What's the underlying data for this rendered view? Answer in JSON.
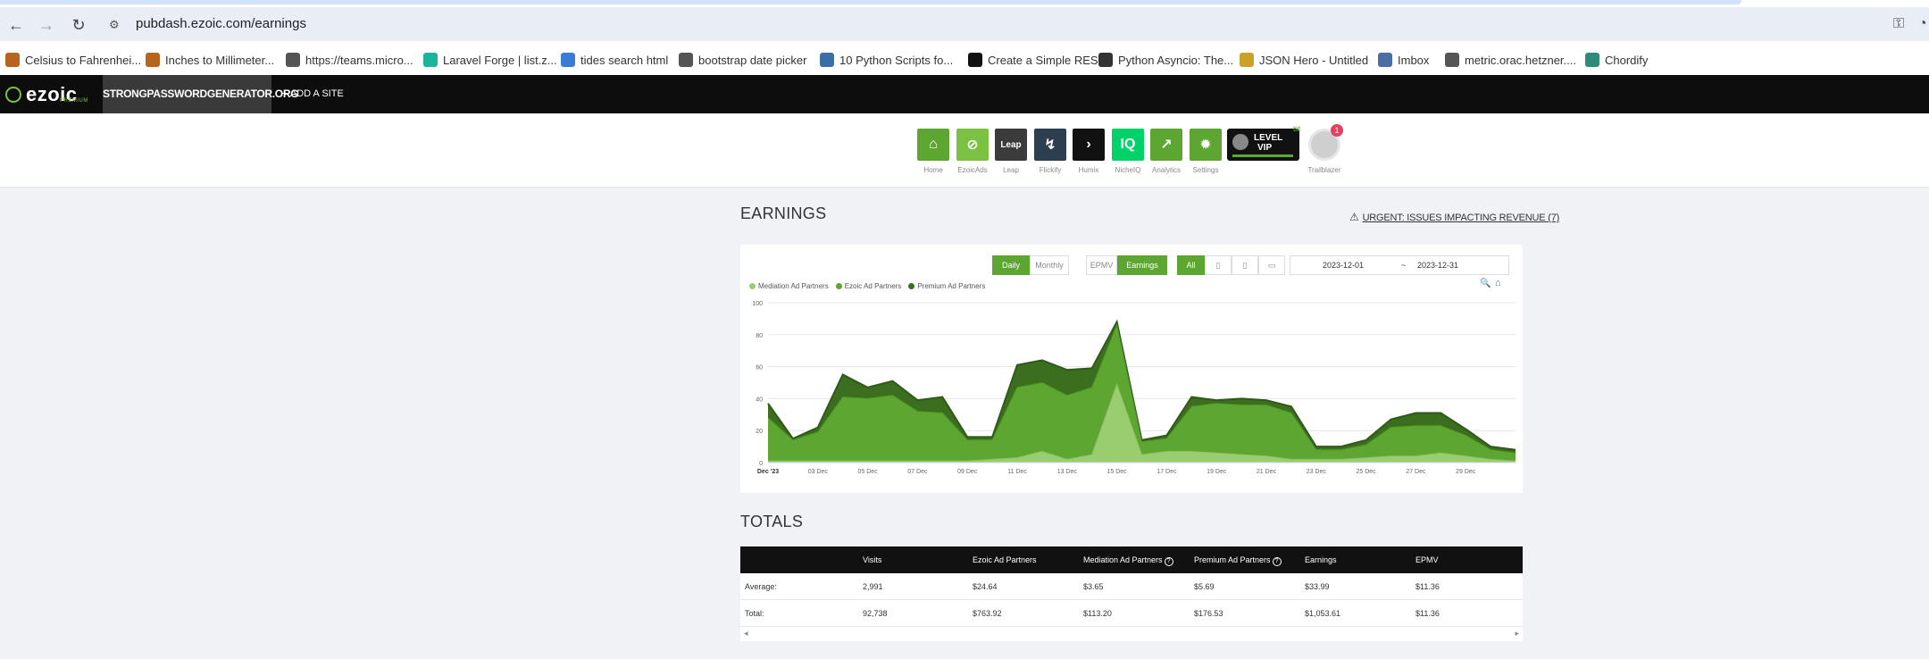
{
  "browser": {
    "url": "pubdash.ezoic.com/earnings",
    "bookmarks": [
      {
        "label": "Celsius to Fahrenhei...",
        "color": "#b5651d"
      },
      {
        "label": "Inches to Millimeter...",
        "color": "#b5651d"
      },
      {
        "label": "https://teams.micro...",
        "color": "#555555"
      },
      {
        "label": "Laravel Forge | list.z...",
        "color": "#19b69b"
      },
      {
        "label": "tides search html",
        "color": "#3a7bd5"
      },
      {
        "label": "bootstrap date picker",
        "color": "#555555"
      },
      {
        "label": "10 Python Scripts fo...",
        "color": "#3a6fa5"
      },
      {
        "label": "Create a Simple RES...",
        "color": "#111111"
      },
      {
        "label": "Python Asyncio: The...",
        "color": "#333333"
      },
      {
        "label": "JSON Hero - Untitled",
        "color": "#c9a227"
      },
      {
        "label": "Imbox",
        "color": "#4a6fa5"
      },
      {
        "label": "metric.orac.hetzner....",
        "color": "#555555"
      },
      {
        "label": "Chordify",
        "color": "#2e8b7a"
      }
    ]
  },
  "header": {
    "logo_text": "ezoic",
    "logo_sub": "PREMIUM",
    "site_name": "STRONGPASSWORDGENERATOR.ORG",
    "add_site": "+ ADD A SITE"
  },
  "apps": [
    {
      "label": "Home",
      "color": "#5da631",
      "icon": "home-icon",
      "glyph": "⌂"
    },
    {
      "label": "EzoicAds",
      "color": "#7cc242",
      "icon": "ezoicads-icon",
      "glyph": "⊘"
    },
    {
      "label": "Leap",
      "color": "#3b3b3b",
      "icon": "leap-icon",
      "glyph": "Leap"
    },
    {
      "label": "Flickify",
      "color": "#2c3e50",
      "icon": "flickify-icon",
      "glyph": "↯"
    },
    {
      "label": "Humix",
      "color": "#111111",
      "icon": "humix-icon",
      "glyph": "›"
    },
    {
      "label": "NicheIQ",
      "color": "#00d26a",
      "icon": "nicheiq-icon",
      "glyph": "IQ"
    },
    {
      "label": "Analytics",
      "color": "#5da631",
      "icon": "analytics-icon",
      "glyph": "↗"
    },
    {
      "label": "Settings",
      "color": "#5da631",
      "icon": "settings-icon",
      "glyph": "✹"
    }
  ],
  "level_badge": {
    "line1": "LEVEL",
    "line2": "VIP"
  },
  "trailblazer": {
    "label": "Trailblazer",
    "badge": "1"
  },
  "earnings": {
    "title": "EARNINGS",
    "urgent": "URGENT: ISSUES IMPACTING REVENUE (7)"
  },
  "controls": {
    "daily": "Daily",
    "monthly": "Monthly",
    "epmv": "EPMV",
    "earnings": "Earnings",
    "all": "All",
    "start_date": "2023-12-01",
    "separator": "~",
    "end_date": "2023-12-31"
  },
  "colors": {
    "mediation": "#9acd70",
    "ezoic": "#5da631",
    "premium": "#3c6e1f",
    "accent": "#5da631"
  },
  "chart_data": {
    "type": "area",
    "stacked": true,
    "legend": [
      "Mediation Ad Partners",
      "Ezoic Ad Partners",
      "Premium Ad Partners"
    ],
    "legend_placement": "top-left",
    "x": [
      "Dec '23",
      "02 Dec",
      "03 Dec",
      "04 Dec",
      "05 Dec",
      "06 Dec",
      "07 Dec",
      "08 Dec",
      "09 Dec",
      "10 Dec",
      "11 Dec",
      "12 Dec",
      "13 Dec",
      "14 Dec",
      "15 Dec",
      "16 Dec",
      "17 Dec",
      "18 Dec",
      "19 Dec",
      "20 Dec",
      "21 Dec",
      "22 Dec",
      "23 Dec",
      "24 Dec",
      "25 Dec",
      "26 Dec",
      "27 Dec",
      "28 Dec",
      "29 Dec",
      "30 Dec",
      "31 Dec"
    ],
    "xtick_labels": [
      "Dec '23",
      "03 Dec",
      "05 Dec",
      "07 Dec",
      "09 Dec",
      "11 Dec",
      "13 Dec",
      "15 Dec",
      "17 Dec",
      "19 Dec",
      "21 Dec",
      "23 Dec",
      "25 Dec",
      "27 Dec",
      "29 Dec"
    ],
    "series": [
      {
        "name": "Mediation Ad Partners",
        "values": [
          1,
          1,
          1,
          1,
          1,
          1,
          1,
          1,
          1,
          2,
          3,
          7,
          2,
          5,
          49,
          5,
          7,
          7,
          6,
          5,
          4,
          2,
          2,
          2,
          3,
          4,
          4,
          6,
          4,
          2,
          1
        ]
      },
      {
        "name": "Ezoic Ad Partners",
        "values": [
          27,
          13,
          18,
          40,
          39,
          41,
          31,
          30,
          13,
          12,
          44,
          43,
          40,
          42,
          37,
          8,
          8,
          28,
          31,
          31,
          32,
          29,
          6,
          6,
          8,
          18,
          19,
          17,
          13,
          6,
          5
        ]
      },
      {
        "name": "Premium Ad Partners",
        "values": [
          9,
          1,
          3,
          14,
          7,
          9,
          7,
          10,
          2,
          2,
          14,
          14,
          16,
          12,
          2,
          1,
          2,
          6,
          2,
          4,
          3,
          4,
          2,
          2,
          3,
          5,
          8,
          8,
          4,
          2,
          2
        ]
      }
    ],
    "ylim": [
      0,
      100
    ],
    "yticks": [
      0,
      20,
      40,
      60,
      80,
      100
    ],
    "grid": true
  },
  "totals": {
    "title": "TOTALS",
    "columns": [
      "",
      "Visits",
      "Ezoic Ad Partners",
      "Mediation Ad Partners",
      "Premium Ad Partners",
      "Earnings",
      "EPMV"
    ],
    "rows": [
      [
        "Average:",
        "2,991",
        "$24.64",
        "$3.65",
        "$5.69",
        "$33.99",
        "$11.36"
      ],
      [
        "Total:",
        "92,738",
        "$763.92",
        "$113.20",
        "$176.53",
        "$1,053.61",
        "$11.36"
      ]
    ]
  }
}
